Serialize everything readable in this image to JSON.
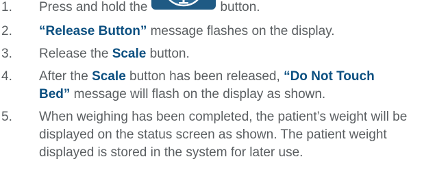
{
  "steps": [
    {
      "number": "1.",
      "parts": {
        "a": "Press and hold the",
        "b": "button."
      },
      "icon": "scale-button-icon"
    },
    {
      "number": "2.",
      "parts": {
        "q1": "“",
        "bold": "Release Button",
        "q2": "”",
        "rest": " message flashes on the display."
      }
    },
    {
      "number": "3.",
      "parts": {
        "a": "Release the ",
        "bold": "Scale",
        "b": " button."
      }
    },
    {
      "number": "4.",
      "parts": {
        "a": "After the ",
        "bold1": "Scale",
        "b": " button has been released, ",
        "q1": "“",
        "bold2": "Do Not Touch Bed",
        "q2": "”",
        "c": " message will flash on the display as shown."
      }
    },
    {
      "number": "5.",
      "text": "When weighing has been completed, the patient’s weight will be displayed on the status screen as shown. The patient weight displayed is stored in the system for later use."
    }
  ],
  "colors": {
    "body_text": "#5a5e61",
    "emphasis": "#0b4f80",
    "icon_fill": "#1f5a84"
  }
}
